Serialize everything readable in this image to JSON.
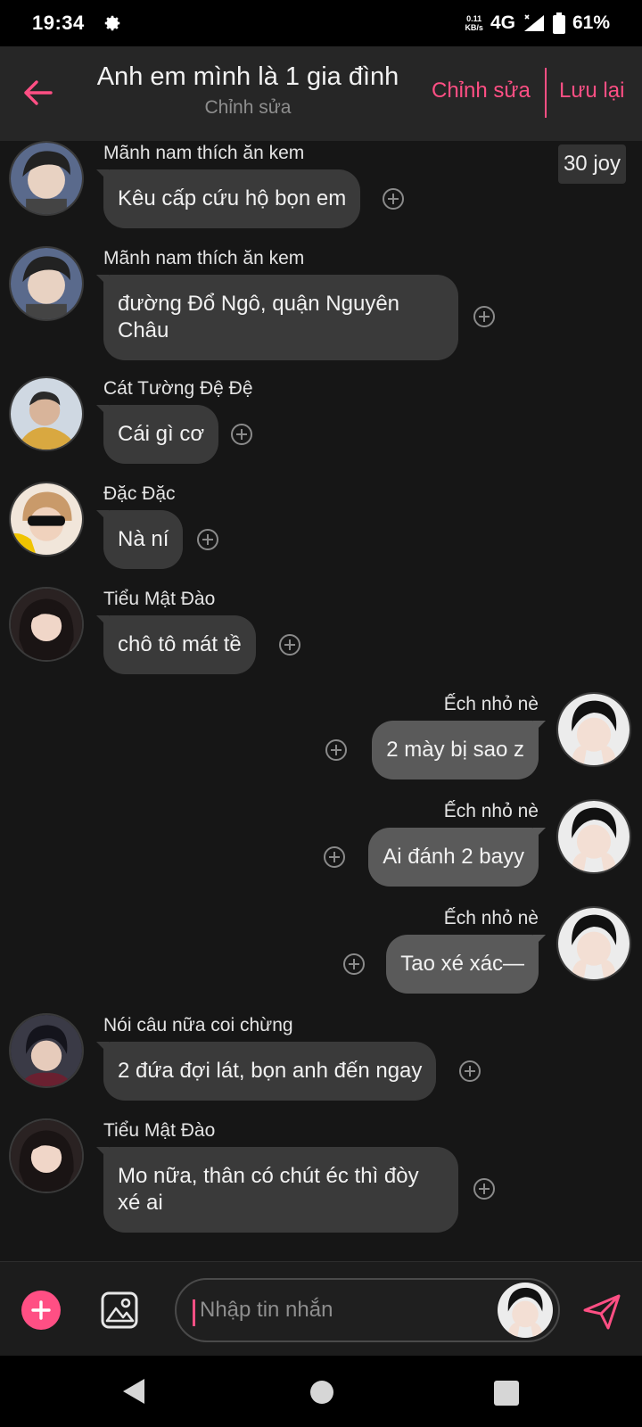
{
  "status_bar": {
    "time": "19:34",
    "net_speed_value": "0.11",
    "net_speed_unit": "KB/s",
    "network": "4G",
    "battery": "61%"
  },
  "header": {
    "title": "Anh em mình là 1 gia đình",
    "subtitle": "Chỉnh sửa",
    "edit_label": "Chỉnh sửa",
    "save_label": "Lưu lại",
    "accent_color": "#ff4f84"
  },
  "badge": "30 joy",
  "messages": [
    {
      "side": "left",
      "name": "Mãnh nam thích ăn kem",
      "text": "Kêu cấp cứu hộ bọn em"
    },
    {
      "side": "left",
      "name": "Mãnh nam thích ăn kem",
      "text": "đường Đổ Ngô, quận Nguyên\nChâu"
    },
    {
      "side": "left",
      "name": "Cát Tường Đệ Đệ",
      "text": "Cái gì cơ"
    },
    {
      "side": "left",
      "name": "Đặc Đặc",
      "text": "Nà ní"
    },
    {
      "side": "left",
      "name": "Tiểu Mật Đào",
      "text": "chô tô mát tề"
    },
    {
      "side": "right",
      "name": "Ếch nhỏ nè",
      "text": "2 mày bị sao z"
    },
    {
      "side": "right",
      "name": "Ếch nhỏ nè",
      "text": "Ai đánh 2 bayy"
    },
    {
      "side": "right",
      "name": "Ếch nhỏ nè",
      "text": "Tao xé xác—"
    },
    {
      "side": "left",
      "name": "Nói câu nữa coi chừng",
      "text": "2 đứa đợi lát, bọn anh đến ngay"
    },
    {
      "side": "left",
      "name": "Tiểu Mật Đào",
      "text": "Mo nữa, thân có chút éc thì đòy\nxé ai"
    }
  ],
  "composer": {
    "placeholder": "Nhập tin nhắn"
  }
}
